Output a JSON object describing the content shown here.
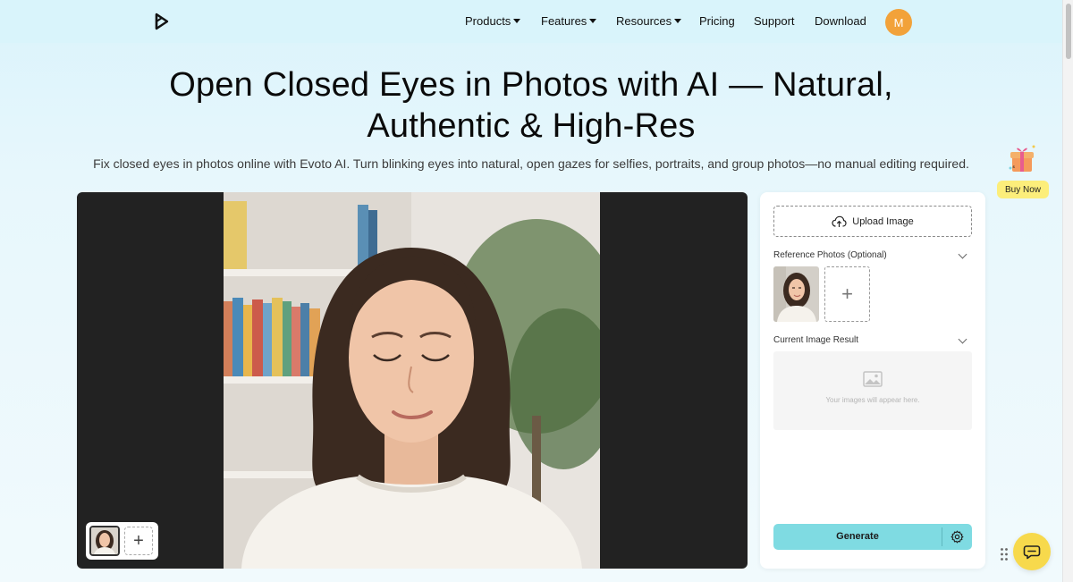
{
  "nav": {
    "items": [
      {
        "label": "Products",
        "dropdown": true
      },
      {
        "label": "Features",
        "dropdown": true
      },
      {
        "label": "Resources",
        "dropdown": true
      },
      {
        "label": "Pricing",
        "dropdown": false
      },
      {
        "label": "Support",
        "dropdown": false
      },
      {
        "label": "Download",
        "dropdown": false
      }
    ],
    "avatar_initial": "M",
    "avatar_color": "#f2a23a"
  },
  "hero": {
    "title_line1": "Open Closed Eyes in Photos with AI — Natural,",
    "title_line2": "Authentic & High-Res",
    "subtitle": "Fix closed eyes in photos online with Evoto AI. Turn blinking eyes into natural, open gazes for selfies, portraits, and group photos—no manual editing required."
  },
  "promo": {
    "buy_now_label": "Buy Now",
    "icon": "gift-box-icon"
  },
  "panel": {
    "upload_label": "Upload Image",
    "reference_label": "Reference Photos (Optional)",
    "add_symbol": "+",
    "result_label": "Current Image Result",
    "result_placeholder": "Your images will appear here.",
    "generate_label": "Generate"
  },
  "preview": {
    "add_symbol": "+"
  },
  "colors": {
    "accent": "#7fdbe2",
    "promo_yellow": "#fcee7b",
    "chat_yellow": "#f7d94c"
  }
}
